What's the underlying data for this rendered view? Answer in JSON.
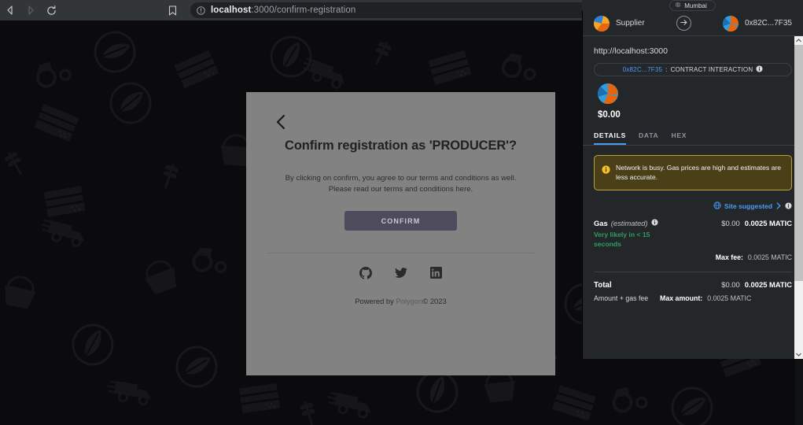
{
  "browser": {
    "back_icon": "back-arrow-icon",
    "forward_icon": "forward-arrow-icon",
    "reload_icon": "reload-icon",
    "bookmark_icon": "bookmark-icon",
    "site_info_icon": "not-secure-info-icon",
    "zoom_icon": "zoom-out-icon",
    "url_host": "localhost",
    "url_path": ":3000/confirm-registration",
    "url_full": "localhost:3000/confirm-registration"
  },
  "page": {
    "card": {
      "back_icon": "chevron-left-icon",
      "title": "Confirm registration as 'PRODUCER'?",
      "terms_line1": "By clicking on confirm, you agree to our terms and conditions as well.",
      "terms_line2": "Please read our terms and conditions here.",
      "confirm_label": "CONFIRM",
      "socials": [
        {
          "name": "github-icon",
          "label": "GitHub"
        },
        {
          "name": "twitter-icon",
          "label": "Twitter"
        },
        {
          "name": "linkedin-icon",
          "label": "LinkedIn"
        }
      ],
      "footer_prefix": "Powered by ",
      "footer_brand": "Polygon",
      "footer_suffix": "© 2023"
    }
  },
  "metamask": {
    "network": {
      "name": "Mumbai",
      "icon": "network-globe-icon"
    },
    "sender": {
      "name": "Supplier",
      "avatar": "sender-jazzicon"
    },
    "recipient": {
      "name": "0x82C...7F35",
      "avatar": "recipient-jazzicon"
    },
    "arrow_icon": "arrow-right-icon",
    "origin": "http://localhost:3000",
    "contract_pill": {
      "address": "0x82C...7F35",
      "separator": " : ",
      "action": "CONTRACT INTERACTION",
      "info_icon": "info-icon"
    },
    "amount": {
      "token_icon": "token-jazzicon",
      "fiat": "$0.00"
    },
    "tabs": [
      {
        "label": "DETAILS",
        "active": true
      },
      {
        "label": "DATA",
        "active": false
      },
      {
        "label": "HEX",
        "active": false
      }
    ],
    "warning": {
      "icon": "warning-info-icon",
      "text": "Network is busy. Gas prices are high and estimates are less accurate.",
      "color": "#b8a339"
    },
    "site_suggested": {
      "globe_icon": "globe-icon",
      "label": "Site suggested",
      "chevron_icon": "chevron-right-icon",
      "info_icon": "info-icon"
    },
    "gas": {
      "label": "Gas",
      "qualifier": "(estimated)",
      "info_icon": "info-icon",
      "fiat": "$0.00",
      "amount": "0.0025 MATIC",
      "speed": "Very likely in < 15 seconds",
      "speed_color": "#2f9e5e",
      "max_fee_label": "Max fee:",
      "max_fee_value": "0.0025 MATIC"
    },
    "total": {
      "label": "Total",
      "fiat": "$0.00",
      "amount": "0.0025 MATIC",
      "subtitle": "Amount + gas fee",
      "max_amount_label": "Max amount:",
      "max_amount_value": "0.0025 MATIC"
    },
    "accent_color": "#4d9bf5"
  }
}
